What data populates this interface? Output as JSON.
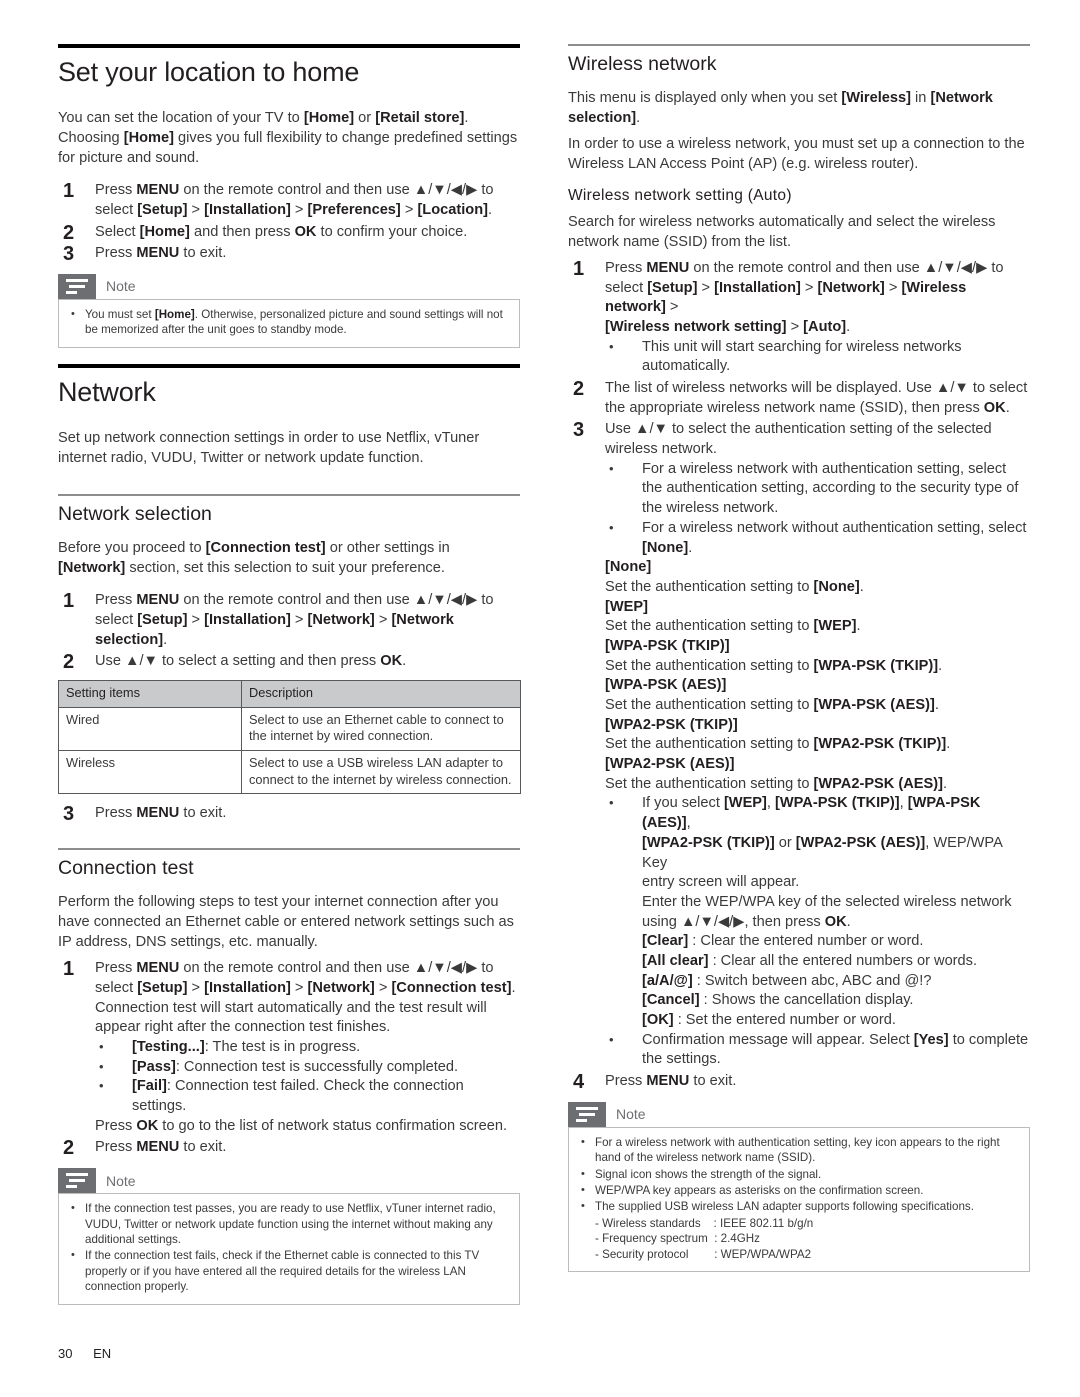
{
  "page": {
    "number": "30",
    "lang": "EN"
  },
  "note_label": "Note",
  "left": {
    "section_title": "Set your location to home",
    "intro": "You can set the location of your TV to [Home] or [Retail store]. Choosing [Home] gives you full flexibility to change predefined settings for picture and sound.",
    "steps": [
      {
        "num": "1",
        "line1": "Press MENU on the remote control and then use ▲/▼/◀/▶ to",
        "line2": "select [Setup] > [Installation] > [Preferences] > [Location]."
      },
      {
        "num": "2",
        "line1": "Select [Home] and then press OK to confirm your choice."
      },
      {
        "num": "3",
        "line1": "Press MENU to exit."
      }
    ],
    "note_items": [
      "You must set [Home]. Otherwise, personalized picture and sound settings will not be memorized after the unit goes to standby mode."
    ],
    "network": {
      "title": "Network",
      "intro": "Set up network connection settings in order to use Netflix, vTuner internet radio, VUDU, Twitter or network update function."
    },
    "network_selection": {
      "title": "Network selection",
      "intro": "Before you proceed to [Connection test] or other settings in [Network] section, set this selection to suit your preference.",
      "steps": [
        {
          "num": "1",
          "line1": "Press MENU on the remote control and then use ▲/▼/◀/▶ to",
          "line2": "select [Setup] > [Installation] > [Network] > [Network selection]."
        },
        {
          "num": "2",
          "line1": "Use ▲/▼ to select a setting and then press OK."
        }
      ],
      "table": {
        "headers": [
          "Setting items",
          "Description"
        ],
        "rows": [
          [
            "Wired",
            "Select to use an Ethernet cable to connect to the internet by wired connection."
          ],
          [
            "Wireless",
            "Select to use a USB wireless LAN adapter to connect to the internet by wireless connection."
          ]
        ]
      },
      "final_step": {
        "num": "3",
        "line1": "Press MENU to exit."
      }
    },
    "connection_test": {
      "title": "Connection test",
      "intro": "Perform the following steps to test your internet connection after you have connected an Ethernet cable or entered network settings such as IP address, DNS settings, etc. manually.",
      "step1_num": "1",
      "step1_line1": "Press MENU on the remote control and then use ▲/▼/◀/▶ to",
      "step1_line2": "select [Setup] > [Installation] > [Network] > [Connection test].",
      "step1_line3": "Connection test will start automatically and the test result will",
      "step1_line4": "appear right after the connection test finishes.",
      "bullets": [
        "[Testing...]: The test is in progress.",
        "[Pass]: Connection test is successfully completed.",
        "[Fail]: Connection test failed. Check the connection settings."
      ],
      "press_ok_line": "Press OK to go to the list of network status confirmation screen.",
      "step2_num": "2",
      "step2_line1": "Press MENU to exit.",
      "note_items": [
        "If the connection test passes, you are ready to use Netflix, vTuner internet radio, VUDU, Twitter or network update function using the internet without making any additional settings.",
        "If the connection test fails, check if the Ethernet cable is connected to this TV properly or if you have entered all the required details for the wireless LAN connection properly."
      ]
    }
  },
  "right": {
    "wireless_network": {
      "title": "Wireless network",
      "para1": "This menu is displayed only when you set [Wireless] in  [Network selection].",
      "para2": "In order to use a wireless network, you must set up a connection to the Wireless LAN Access Point (AP) (e.g. wireless router)."
    },
    "wireless_setting_auto": {
      "title": "Wireless network setting (Auto)",
      "intro": "Search for wireless networks automatically and select the wireless network name (SSID) from the list.",
      "step1_num": "1",
      "step1_line1": "Press MENU on the remote control and then use ▲/▼/◀/▶ to",
      "step1_line2": "select [Setup] > [Installation] > [Network] > [Wireless network] >",
      "step1_line3": "[Wireless network setting] > [Auto].",
      "step1_bullet": "This unit will start searching for wireless networks automatically.",
      "step2_num": "2",
      "step2_line1": "The list of wireless networks will be displayed. Use ▲/▼ to select",
      "step2_line2": "the appropriate wireless network name (SSID), then press OK.",
      "step3_num": "3",
      "step3_line1": "Use ▲/▼ to select the authentication setting of the selected",
      "step3_line2": "wireless network.",
      "step3_bullets": [
        "For a wireless network with authentication setting, select the authentication setting, according to the security type of the wireless network.",
        "For a wireless network without authentication setting, select [None]."
      ],
      "auth_types": [
        {
          "key": "[None]",
          "desc": "Set the authentication setting to [None]."
        },
        {
          "key": "[WEP]",
          "desc": "Set the authentication setting to [WEP]."
        },
        {
          "key": "[WPA-PSK (TKIP)]",
          "desc": "Set the authentication setting to [WPA-PSK (TKIP)]."
        },
        {
          "key": "[WPA-PSK (AES)]",
          "desc": "Set the authentication setting to [WPA-PSK (AES)]."
        },
        {
          "key": "[WPA2-PSK (TKIP)]",
          "desc": "Set the authentication setting to [WPA2-PSK (TKIP)]."
        },
        {
          "key": "[WPA2-PSK (AES)]",
          "desc": "Set the authentication setting to [WPA2-PSK (AES)]."
        }
      ],
      "key_entry": {
        "line1": "If you select [WEP], [WPA-PSK (TKIP)], [WPA-PSK (AES)],",
        "line2": "[WPA2-PSK (TKIP)] or [WPA2-PSK (AES)], WEP/WPA Key",
        "line3": "entry screen will appear.",
        "line4": "Enter the WEP/WPA key of the selected wireless network",
        "line5": "using ▲/▼/◀/▶, then press OK.",
        "keys": [
          {
            "label": "[Clear]",
            "desc": ": Clear the entered number or word."
          },
          {
            "label": "[All clear]",
            "desc": ": Clear all the entered numbers or words."
          },
          {
            "label": "[a/A/@]",
            "desc": ": Switch between abc, ABC and @!?"
          },
          {
            "label": "[Cancel]",
            "desc": ": Shows the cancellation display."
          },
          {
            "label": "[OK]",
            "desc": ": Set the entered number or word."
          }
        ]
      },
      "confirm_bullet": "Confirmation message will appear. Select [Yes] to complete the settings.",
      "step4_num": "4",
      "step4_line1": "Press MENU to exit.",
      "note_items": [
        "For a wireless network with authentication setting, key icon appears to the right hand of the wireless network name (SSID).",
        "Signal icon shows the strength of the signal.",
        "WEP/WPA key appears as asterisks on the confirmation screen.",
        "The supplied USB wireless LAN adapter supports following specifications."
      ],
      "specs": [
        "- Wireless standards    : IEEE 802.11 b/g/n",
        "- Frequency spectrum  : 2.4GHz",
        "- Security protocol        : WEP/WPA/WPA2"
      ]
    }
  }
}
